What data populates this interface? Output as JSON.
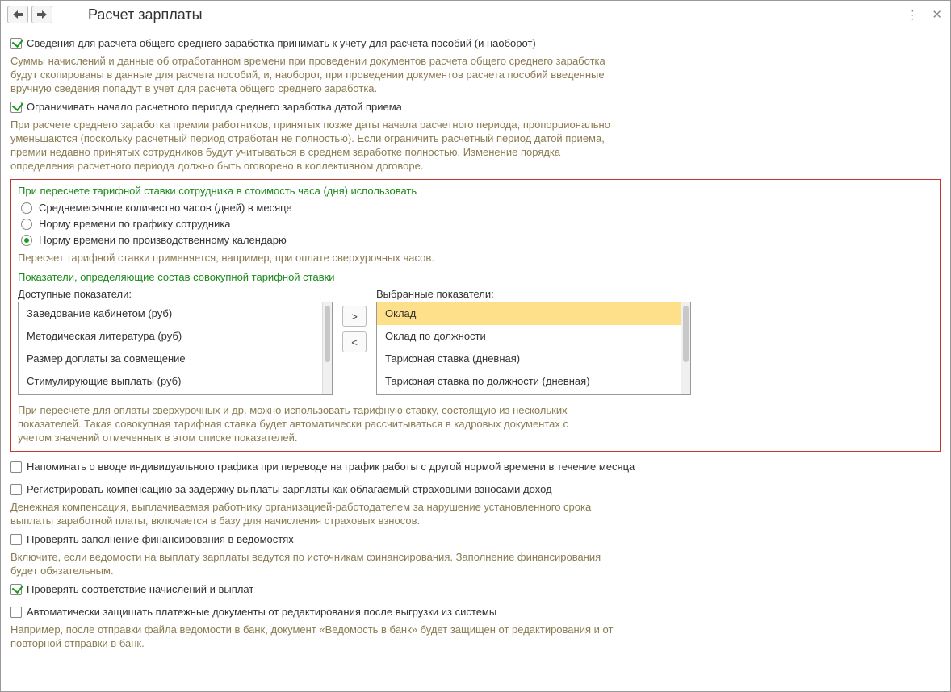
{
  "header": {
    "title": "Расчет зарплаты"
  },
  "cb1": {
    "label": "Сведения для расчета общего среднего заработка принимать к учету для расчета пособий (и наоборот)",
    "hint": "Суммы начислений и данные об отработанном времени при проведении документов расчета общего среднего заработка будут скопированы в данные для расчета пособий, и, наоборот, при проведении документов расчета пособий введенные вручную сведения попадут в учет для расчета общего среднего заработка."
  },
  "cb2": {
    "label": "Ограничивать начало расчетного периода среднего заработка датой приема",
    "hint": "При расчете среднего заработка премии работников, принятых позже даты начала расчетного периода, пропорционально уменьшаются (поскольку расчетный период отработан не полностью). Если ограничить расчетный период датой приема, премии недавно принятых сотрудников будут учитываться в среднем заработке полностью. Изменение порядка определения расчетного периода должно быть оговорено в коллективном договоре."
  },
  "group1": {
    "title": "При пересчете тарифной ставки сотрудника в стоимость часа (дня) использовать",
    "opt1": "Среднемесячное количество часов (дней) в месяце",
    "opt2": "Норму времени по графику сотрудника",
    "opt3": "Норму времени по производственному календарю",
    "hint": "Пересчет тарифной ставки применяется, например, при оплате сверхурочных часов."
  },
  "group2": {
    "title": "Показатели, определяющие состав совокупной тарифной ставки",
    "available_label": "Доступные показатели:",
    "selected_label": "Выбранные показатели:",
    "available": {
      "i0": "Заведование кабинетом (руб)",
      "i1": "Методическая литература (руб)",
      "i2": "Размер доплаты за совмещение",
      "i3": "Стимулирующие выплаты (руб)"
    },
    "selected": {
      "i0": "Оклад",
      "i1": "Оклад по должности",
      "i2": "Тарифная ставка (дневная)",
      "i3": "Тарифная ставка по должности (дневная)"
    },
    "btn_right": ">",
    "btn_left": "<",
    "hint": "При пересчете для оплаты сверхурочных и др. можно использовать тарифную ставку, состоящую из нескольких показателей. Такая совокупная тарифная ставка будет автоматически рассчитываться в кадровых документах с учетом значений отмеченных в этом списке показателей."
  },
  "cb3": {
    "label": "Напоминать о вводе индивидуального графика при переводе на график работы с другой нормой времени в течение месяца"
  },
  "cb4": {
    "label": "Регистрировать компенсацию за задержку выплаты зарплаты как облагаемый страховыми взносами доход",
    "hint": "Денежная компенсация, выплачиваемая работнику организацией-работодателем за нарушение установленного срока выплаты заработной платы, включается в базу для начисления страховых взносов."
  },
  "cb5": {
    "label": "Проверять заполнение финансирования в ведомостях",
    "hint": "Включите, если ведомости на выплату зарплаты ведутся по источникам финансирования. Заполнение финансирования будет обязательным."
  },
  "cb6": {
    "label": "Проверять соответствие начислений и выплат"
  },
  "cb7": {
    "label": "Автоматически защищать платежные документы от редактирования после выгрузки из системы",
    "hint": "Например, после отправки файла ведомости в банк, документ «Ведомость в банк» будет защищен от редактирования и от повторной отправки в банк."
  }
}
